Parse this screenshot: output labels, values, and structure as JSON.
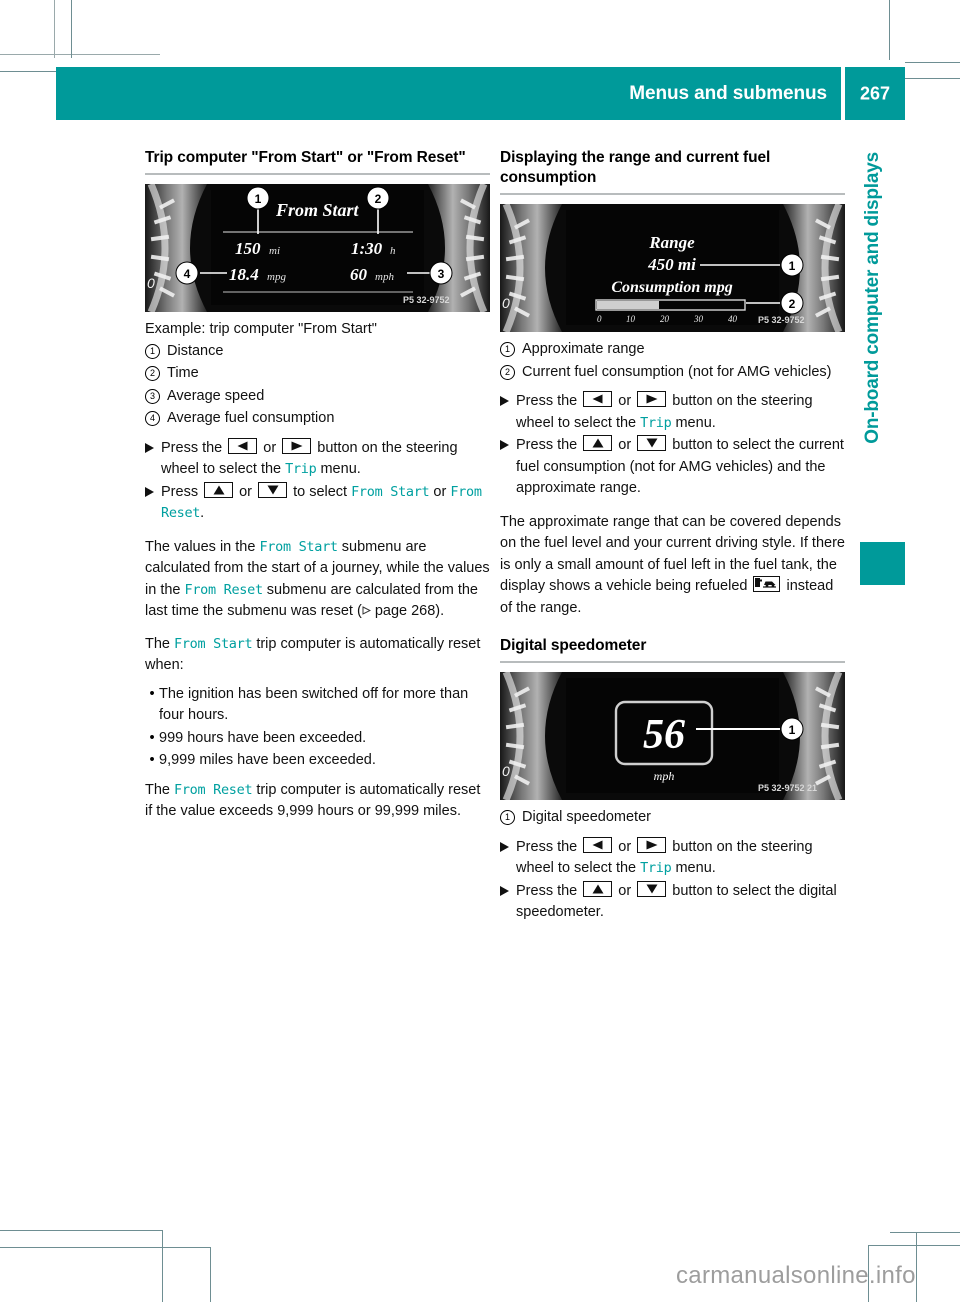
{
  "header": {
    "title": "Menus and submenus",
    "page_number": "267"
  },
  "side_tab": {
    "label": "On-board computer and displays"
  },
  "watermark": "carmanualsonline.info",
  "left_column": {
    "heading": "Trip computer \"From Start\" or \"From Reset\"",
    "figure": {
      "name": "trip-computer-from-start-display",
      "menu_title": "From Start",
      "distance": "150",
      "distance_unit": "mi",
      "time": "1:30",
      "time_unit": "h",
      "consumption": "18.4",
      "consumption_unit": "mpg",
      "speed": "60",
      "speed_unit": "mph",
      "photo_code": "P5 32-9752",
      "callouts": [
        "1",
        "2",
        "3",
        "4"
      ]
    },
    "caption": "Example: trip computer \"From Start\"",
    "callouts": [
      {
        "num": "1",
        "text": "Distance"
      },
      {
        "num": "2",
        "text": "Time"
      },
      {
        "num": "3",
        "text": "Average speed"
      },
      {
        "num": "4",
        "text": "Average fuel consumption"
      }
    ],
    "actions": [
      {
        "parts": [
          {
            "t": "text",
            "v": "Press the "
          },
          {
            "t": "key",
            "v": "left-arrow"
          },
          {
            "t": "text",
            "v": " or "
          },
          {
            "t": "key",
            "v": "right-arrow"
          },
          {
            "t": "text",
            "v": " button on the steering wheel to select the "
          },
          {
            "t": "mono",
            "v": "Trip"
          },
          {
            "t": "text",
            "v": " menu."
          }
        ]
      },
      {
        "parts": [
          {
            "t": "text",
            "v": "Press "
          },
          {
            "t": "key",
            "v": "up-arrow"
          },
          {
            "t": "text",
            "v": " or "
          },
          {
            "t": "key",
            "v": "down-arrow"
          },
          {
            "t": "text",
            "v": " to select "
          },
          {
            "t": "mono",
            "v": "From Start"
          },
          {
            "t": "text",
            "v": " or "
          },
          {
            "t": "mono",
            "v": "From Reset"
          },
          {
            "t": "text",
            "v": "."
          }
        ]
      }
    ],
    "para1_a": "The values in the ",
    "para1_mono1": "From Start",
    "para1_b": " submenu are calculated from the start of a journey, while the values in the ",
    "para1_mono2": "From Reset",
    "para1_c": " submenu are calculated from the last time the submenu was reset (",
    "para1_pageref": " page 268).",
    "para2_a": "The ",
    "para2_mono": "From Start",
    "para2_b": " trip computer is automatically reset when:",
    "bullets": [
      "The ignition has been switched off for more than four hours.",
      "999 hours have been exceeded.",
      "9,999 miles have been exceeded."
    ],
    "para3_a": "The ",
    "para3_mono": "From Reset",
    "para3_b": " trip computer is automatically reset if the value exceeds 9,999 hours or 99,999 miles."
  },
  "right_column": {
    "heading": "Displaying the range and current fuel consumption",
    "figure": {
      "name": "range-and-consumption-display",
      "range_label": "Range",
      "range_value": "450 mi",
      "consumption_label": "Consumption mpg",
      "scale_ticks": [
        "0",
        "10",
        "20",
        "30",
        "40"
      ],
      "photo_code": "P5 32-9752",
      "callouts": [
        "1",
        "2"
      ]
    },
    "callouts": [
      {
        "num": "1",
        "text": "Approximate range"
      },
      {
        "num": "2",
        "text": "Current fuel consumption (not for AMG vehicles)"
      }
    ],
    "actions": [
      {
        "parts": [
          {
            "t": "text",
            "v": "Press the "
          },
          {
            "t": "key",
            "v": "left-arrow"
          },
          {
            "t": "text",
            "v": " or "
          },
          {
            "t": "key",
            "v": "right-arrow"
          },
          {
            "t": "text",
            "v": " button on the steering wheel to select the "
          },
          {
            "t": "mono",
            "v": "Trip"
          },
          {
            "t": "text",
            "v": " menu."
          }
        ]
      },
      {
        "parts": [
          {
            "t": "text",
            "v": "Press the "
          },
          {
            "t": "key",
            "v": "up-arrow"
          },
          {
            "t": "text",
            "v": " or "
          },
          {
            "t": "key",
            "v": "down-arrow"
          },
          {
            "t": "text",
            "v": " button to select the current fuel consumption (not for AMG vehicles) and the approximate range."
          }
        ]
      }
    ],
    "para_a": "The approximate range that can be covered depends on the fuel level and your current driving style. If there is only a small amount of fuel left in the fuel tank, the display shows a vehicle being refueled ",
    "para_b": " instead of the range.",
    "heading2": "Digital speedometer",
    "figure2": {
      "name": "digital-speedometer-display",
      "speed": "56",
      "unit": "mph",
      "photo_code": "P5 32-9752",
      "callouts": [
        "1"
      ]
    },
    "callouts2": [
      {
        "num": "1",
        "text": "Digital speedometer"
      }
    ],
    "actions2": [
      {
        "parts": [
          {
            "t": "text",
            "v": "Press the "
          },
          {
            "t": "key",
            "v": "left-arrow"
          },
          {
            "t": "text",
            "v": " or "
          },
          {
            "t": "key",
            "v": "right-arrow"
          },
          {
            "t": "text",
            "v": " button on the steering wheel to select the "
          },
          {
            "t": "mono",
            "v": "Trip"
          },
          {
            "t": "text",
            "v": " menu."
          }
        ]
      },
      {
        "parts": [
          {
            "t": "text",
            "v": "Press the "
          },
          {
            "t": "key",
            "v": "up-arrow"
          },
          {
            "t": "text",
            "v": " or "
          },
          {
            "t": "key",
            "v": "down-arrow"
          },
          {
            "t": "text",
            "v": " button to select the digital speedometer."
          }
        ]
      }
    ]
  },
  "colors": {
    "teal": "#009a9a",
    "mono_teal": "#00a0a0",
    "rule": "#b8bcbd"
  }
}
